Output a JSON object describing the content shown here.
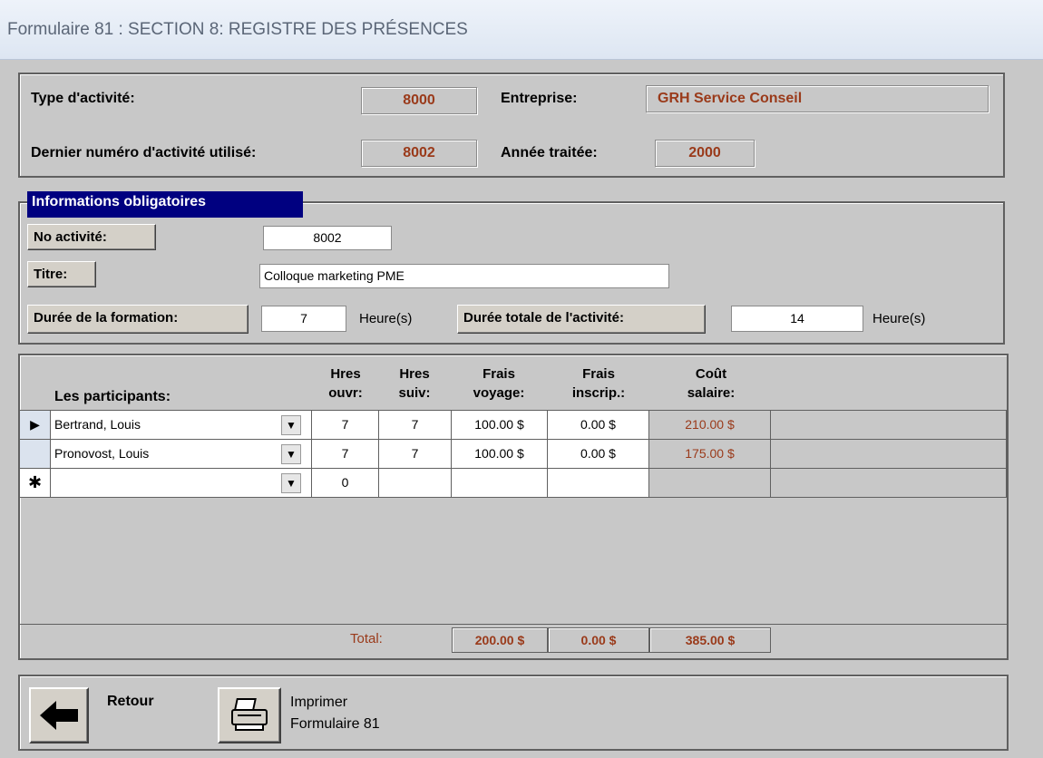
{
  "window": {
    "title": "Formulaire 81 : SECTION 8: REGISTRE DES PRÉSENCES"
  },
  "header": {
    "type_label": "Type d'activité:",
    "type_value": "8000",
    "entreprise_label": "Entreprise:",
    "entreprise_value": "GRH Service Conseil",
    "dernier_label": "Dernier numéro d'activité utilisé:",
    "dernier_value": "8002",
    "annee_label": "Année traitée:",
    "annee_value": "2000"
  },
  "info": {
    "legend": "Informations obligatoires",
    "no_activite_label": "No activité:",
    "no_activite_value": "8002",
    "titre_label": "Titre:",
    "titre_value": "Colloque marketing PME",
    "duree_formation_label": "Durée de la formation:",
    "duree_formation_value": "7",
    "heures_unit": "Heure(s)",
    "duree_totale_label": "Durée totale de l'activité:",
    "duree_totale_value": "14"
  },
  "grid": {
    "col_participants": "Les participants:",
    "col_hres_ouvr": [
      "Hres",
      "ouvr:"
    ],
    "col_hres_suiv": [
      "Hres",
      "suiv:"
    ],
    "col_frais_voyage": [
      "Frais",
      "voyage:"
    ],
    "col_frais_inscrip": [
      "Frais",
      "inscrip.:"
    ],
    "col_cout_salaire": [
      "Coût",
      "salaire:"
    ],
    "rows": [
      {
        "selector": "▶",
        "name": "Bertrand, Louis",
        "ouvr": "7",
        "suiv": "7",
        "voyage": "100.00 $",
        "inscrip": "0.00 $",
        "salaire": "210.00 $"
      },
      {
        "selector": "",
        "name": "Pronovost, Louis",
        "ouvr": "7",
        "suiv": "7",
        "voyage": "100.00 $",
        "inscrip": "0.00 $",
        "salaire": "175.00 $"
      },
      {
        "selector": "✱",
        "name": "",
        "ouvr": "0",
        "suiv": "",
        "voyage": "",
        "inscrip": "",
        "salaire": ""
      }
    ],
    "total_label": "Total:",
    "total_voyage": "200.00 $",
    "total_inscrip": "0.00 $",
    "total_salaire": "385.00 $"
  },
  "footer": {
    "retour_label": "Retour",
    "imprimer_label_1": "Imprimer",
    "imprimer_label_2": "Formulaire 81"
  },
  "icons": {
    "back": "arrow-left-icon",
    "print": "printer-icon",
    "dropdown": "chevron-down-icon"
  },
  "colors": {
    "value_text": "#9a3a1a",
    "legend_bg": "#000080",
    "form_bg": "#c8c8c8"
  }
}
